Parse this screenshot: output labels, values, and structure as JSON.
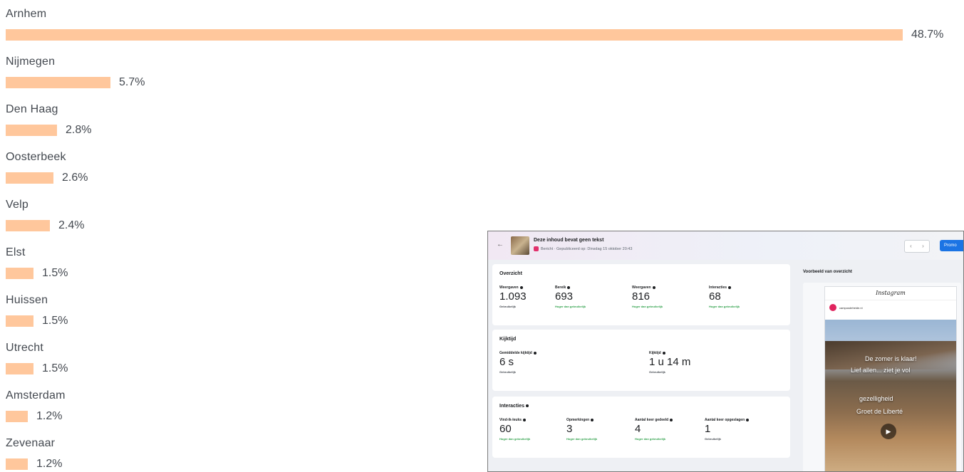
{
  "cities": [
    {
      "name": "Arnhem",
      "pct_label": "48.7%",
      "value": 48.7
    },
    {
      "name": "Nijmegen",
      "pct_label": "5.7%",
      "value": 5.7
    },
    {
      "name": "Den Haag",
      "pct_label": "2.8%",
      "value": 2.8
    },
    {
      "name": "Oosterbeek",
      "pct_label": "2.6%",
      "value": 2.6
    },
    {
      "name": "Velp",
      "pct_label": "2.4%",
      "value": 2.4
    },
    {
      "name": "Elst",
      "pct_label": "1.5%",
      "value": 1.5
    },
    {
      "name": "Huissen",
      "pct_label": "1.5%",
      "value": 1.5
    },
    {
      "name": "Utrecht",
      "pct_label": "1.5%",
      "value": 1.5
    },
    {
      "name": "Amsterdam",
      "pct_label": "1.2%",
      "value": 1.2
    },
    {
      "name": "Zevenaar",
      "pct_label": "1.2%",
      "value": 1.2
    }
  ],
  "colors": {
    "bar": "#ffc79c",
    "accent": "#1b74e4",
    "positive": "#31a24c"
  },
  "panel": {
    "header": {
      "title": "Deze inhoud bevat geen tekst",
      "subtitle": "Bericht · Gepubliceerd op: Dinsdag 15 oktober 20:43",
      "nav_prev": "‹",
      "nav_next": "›",
      "action_button": "Promo"
    },
    "overzicht": {
      "title": "Overzicht",
      "metrics": [
        {
          "label": "Weergaven",
          "value": "1.093",
          "status": "Gebruikelijk"
        },
        {
          "label": "Bereik",
          "value": "693",
          "status": "Hoger dan gebruikelijk"
        },
        {
          "label": "Weergaven",
          "value": "816",
          "status": "Hoger dan gebruikelijk"
        },
        {
          "label": "Interacties",
          "value": "68",
          "status": "Hoger dan gebruikelijk"
        }
      ]
    },
    "kijktijd": {
      "title": "Kijktijd",
      "metrics": [
        {
          "label": "Gemiddelde kijktijd",
          "value": "6 s",
          "status": "Gebruikelijk"
        },
        {
          "label": "Kijktijd",
          "value": "1 u 14 m",
          "status": "Gebruikelijk"
        }
      ]
    },
    "interacties": {
      "title": "Interacties",
      "metrics": [
        {
          "label": "Vind-ik-leuks",
          "value": "60",
          "status": "Hoger dan gebruikelijk"
        },
        {
          "label": "Opmerkingen",
          "value": "3",
          "status": "Hoger dan gebruikelijk"
        },
        {
          "label": "Aantal keer gedeeld",
          "value": "4",
          "status": "Hoger dan gebruikelijk"
        },
        {
          "label": "Aantal keer opgeslagen",
          "value": "1",
          "status": "Gebruikelijk"
        }
      ]
    },
    "preview": {
      "title": "Voorbeeld van overzicht",
      "platform": "Instagram",
      "account": "campusdeheide.nl",
      "overlay_lines": [
        "De zomer is klaar!",
        "Lief allen... ziet je vol",
        "gezelligheid",
        "Groet de Liberté"
      ]
    }
  }
}
